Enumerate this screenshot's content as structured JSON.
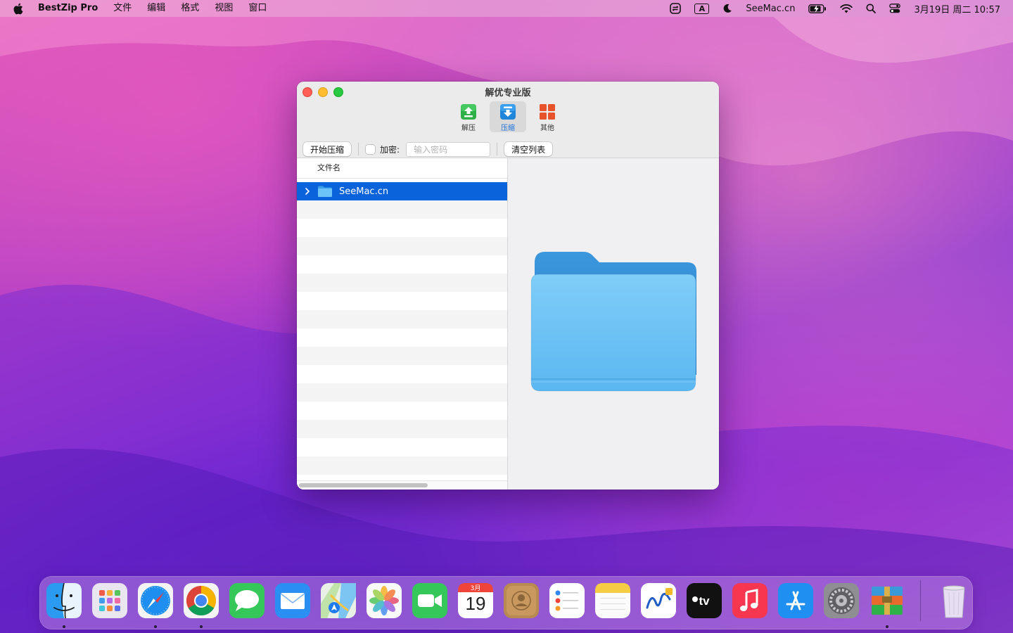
{
  "menubar": {
    "app_name": "BestZip Pro",
    "menus": [
      "文件",
      "编辑",
      "格式",
      "视图",
      "窗口"
    ],
    "input_indicator": "A",
    "site": "SeeMac.cn",
    "datetime": "3月19日 周二  10:57"
  },
  "window": {
    "title": "解优专业版",
    "tabs": [
      {
        "label": "解压",
        "icon": "extract-icon",
        "active": false
      },
      {
        "label": "压缩",
        "icon": "compress-icon",
        "active": true
      },
      {
        "label": "其他",
        "icon": "grid-icon",
        "active": false
      }
    ],
    "actions": {
      "start_label": "开始压缩",
      "encrypt_label": "加密:",
      "password_placeholder": "输入密码",
      "clear_label": "清空列表"
    },
    "list": {
      "column_header": "文件名",
      "items": [
        {
          "name": "SeeMac.cn",
          "type": "folder",
          "selected": true
        }
      ]
    }
  },
  "dock": {
    "calendar_month": "3月",
    "calendar_day": "19",
    "apps": [
      "Finder",
      "Launchpad",
      "Safari",
      "Chrome",
      "Messages",
      "Mail",
      "Maps",
      "Photos",
      "FaceTime",
      "Calendar",
      "Contacts",
      "Reminders",
      "Notes",
      "Freeform",
      "Apple TV",
      "Music",
      "App Store",
      "System Settings",
      "BestZip",
      "Trash"
    ]
  },
  "colors": {
    "selection": "#0a63db",
    "accent": "#1a6fd9"
  }
}
